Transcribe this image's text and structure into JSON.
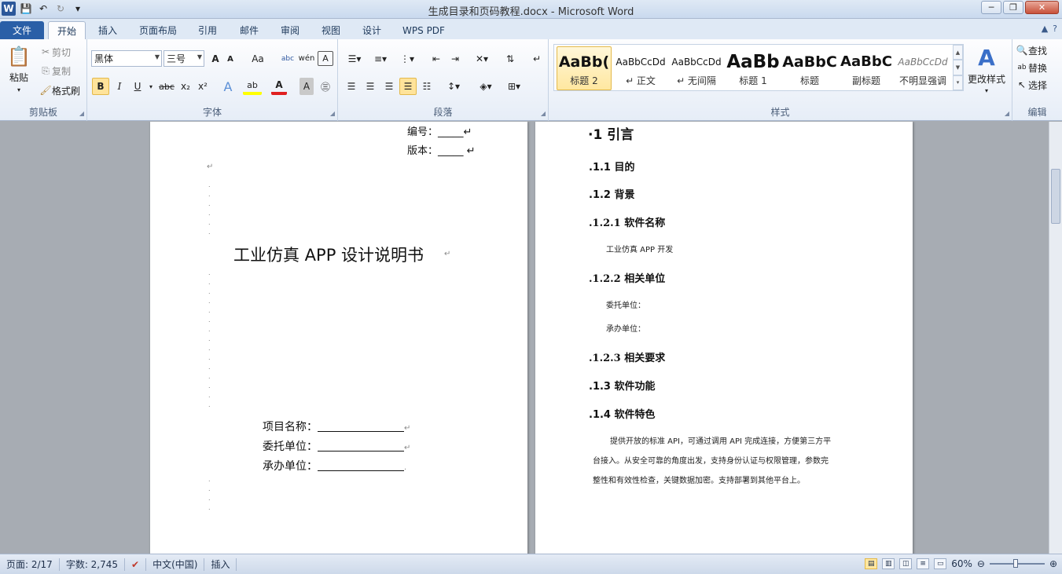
{
  "window": {
    "title": "生成目录和页码教程.docx - Microsoft Word",
    "minimize": "─",
    "restore": "❐",
    "close": "✕"
  },
  "qat": {
    "logo": "W",
    "save_icon": "💾",
    "undo_icon": "↶",
    "redo_icon": "↻",
    "customize_icon": "▾"
  },
  "tabs": [
    "文件",
    "开始",
    "插入",
    "页面布局",
    "引用",
    "邮件",
    "审阅",
    "视图",
    "设计",
    "WPS PDF"
  ],
  "ribbon": {
    "clipboard": {
      "label": "剪贴板",
      "paste": "粘贴",
      "cut": "剪切",
      "copy": "复制",
      "format_painter": "格式刷"
    },
    "font": {
      "label": "字体",
      "font_name": "黑体",
      "font_size": "三号",
      "bold": "B",
      "italic": "I",
      "underline": "U",
      "strike": "abc",
      "subscript": "x₂",
      "superscript": "x²",
      "grow": "A",
      "shrink": "A",
      "case": "Aa",
      "clear": "A"
    },
    "paragraph": {
      "label": "段落"
    },
    "styles": {
      "label": "样式",
      "items": [
        {
          "sample": "AaBb(",
          "name": "标题 2"
        },
        {
          "sample": "AaBbCcDd",
          "name": "↵ 正文"
        },
        {
          "sample": "AaBbCcDd",
          "name": "↵ 无间隔"
        },
        {
          "sample": "AaBb",
          "name": "标题 1"
        },
        {
          "sample": "AaBbC",
          "name": "标题"
        },
        {
          "sample": "AaBbC",
          "name": "副标题"
        },
        {
          "sample": "AaBbCcDd",
          "name": "不明显强调"
        }
      ],
      "change_styles": "更改样式"
    },
    "editing": {
      "label": "编辑",
      "find": "查找",
      "replace": "替换",
      "select": "选择"
    }
  },
  "page1": {
    "number_label": "编号：_____↵",
    "version_label": "版本：_____ ↵",
    "main_title": "工业仿真 APP 设计说明书",
    "fields": [
      {
        "label": "项目名称："
      },
      {
        "label": "委托单位："
      },
      {
        "label": "承办单位："
      }
    ]
  },
  "page2": {
    "h1": "·1 引言",
    "items": [
      {
        "text": ".1.1 目的",
        "level": "h2"
      },
      {
        "text": ".1.2 背景",
        "level": "h2"
      },
      {
        "text": ".1.2.1  软件名称",
        "level": "h3"
      },
      {
        "text": "工业仿真  APP 开发",
        "level": "body"
      },
      {
        "text": ".1.2.2 相关单位",
        "level": "h3"
      },
      {
        "text": "委托单位：",
        "level": "body"
      },
      {
        "text": "承办单位：",
        "level": "body"
      },
      {
        "text": ".1.2.3 相关要求",
        "level": "h3"
      },
      {
        "text": ".1.3 软件功能",
        "level": "h2"
      },
      {
        "text": ".1.4 软件特色",
        "level": "h2"
      }
    ],
    "paragraph": [
      "提供开放的标准 API，可通过调用 API 完成连接，方便第三方平",
      "台接入。从安全可靠的角度出发，支持身份认证与权限管理，参数完",
      "整性和有效性检查，关键数据加密。支持部署到其他平台上。"
    ]
  },
  "status": {
    "page": "页面: 2/17",
    "words": "字数: 2,745",
    "language": "中文(中国)",
    "mode": "插入",
    "zoom": "60%",
    "zoom_percent": 60
  },
  "colors": {
    "file_tab": "#2a5fa7",
    "ribbon_bg": "#e6edf7",
    "doc_bg": "#a7acb3",
    "selected_style": "#ffe7a0"
  }
}
